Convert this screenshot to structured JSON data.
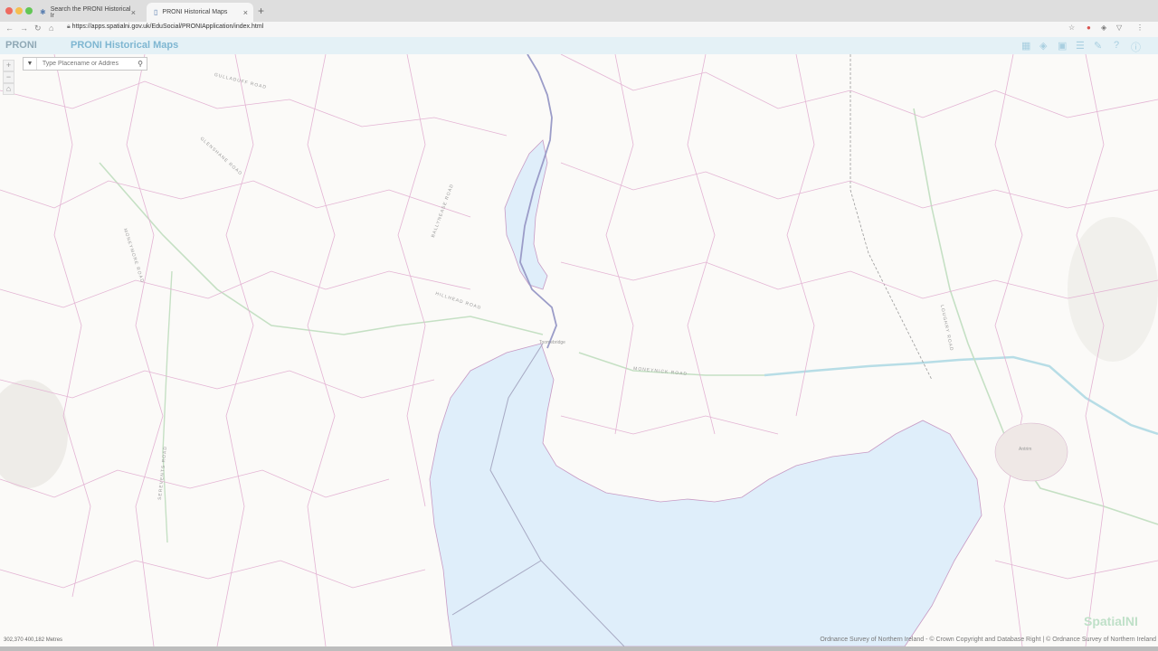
{
  "browser": {
    "tabs": [
      {
        "label": "Search the PRONI Historical Ir",
        "active": false
      },
      {
        "label": "PRONI Historical Maps",
        "active": true
      }
    ],
    "url": "https://apps.spatialni.gov.uk/EduSocial/PRONIApplication/index.html"
  },
  "app": {
    "logo": "PRONI",
    "title": "PRONI Historical Maps",
    "header_icons": [
      "basemap-gallery-icon",
      "layers-icon",
      "map-sheets-icon",
      "legend-icon",
      "education-icon",
      "help-icon",
      "info-icon"
    ]
  },
  "search": {
    "placeholder": "Type Placename or Addres"
  },
  "map": {
    "coordinates": "302,370 400,182 Metres",
    "attribution": "Ordnance Survey of Northern Ireland - © Crown Copyright and Database Right | © Ordnance Survey of Northern Ireland",
    "watermark": "SpatialNI",
    "places": [
      {
        "name": "Antrim"
      },
      {
        "name": "Toomebridge"
      }
    ],
    "roads": [
      {
        "name": "GULLADUFF ROAD"
      },
      {
        "name": "GLENSHANE ROAD"
      },
      {
        "name": "BALLYNEASE ROAD"
      },
      {
        "name": "MONEYMORE ROAD"
      },
      {
        "name": "HILLHEAD ROAD"
      },
      {
        "name": "MONEYNICK ROAD"
      },
      {
        "name": "SEREVENTS ROAD"
      },
      {
        "name": "LOUGHRY ROAD"
      }
    ]
  },
  "colors": {
    "water": "#dfeefa",
    "roads": "#e3b3d3",
    "boundary": "#9b9cc8",
    "header_bg": "#e4f1f6",
    "title": "#7eb6d1"
  }
}
